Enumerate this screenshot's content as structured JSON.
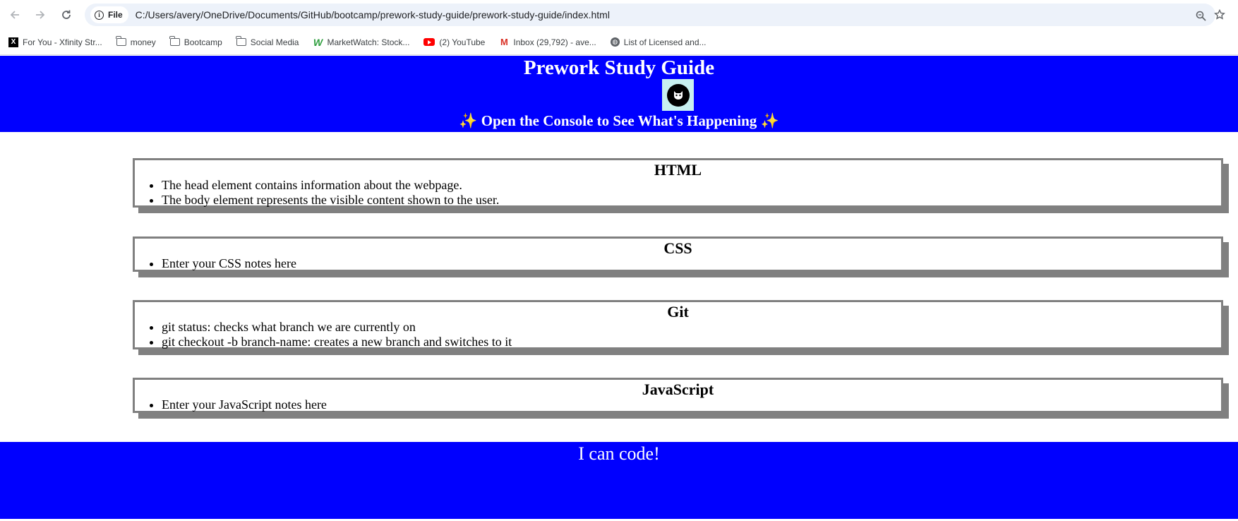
{
  "browser": {
    "site_label": "File",
    "url": "C:/Users/avery/OneDrive/Documents/GitHub/bootcamp/prework-study-guide/prework-study-guide/index.html",
    "icons": [
      "back-icon",
      "forward-icon",
      "reload-icon",
      "info-icon",
      "zoom-icon",
      "star-icon"
    ]
  },
  "bookmarks": [
    {
      "label": "For You - Xfinity Str...",
      "icon": "x-icon"
    },
    {
      "label": "money",
      "icon": "folder-icon"
    },
    {
      "label": "Bootcamp",
      "icon": "folder-icon"
    },
    {
      "label": "Social Media",
      "icon": "folder-icon"
    },
    {
      "label": "MarketWatch: Stock...",
      "icon": "marketwatch-icon"
    },
    {
      "label": "(2) YouTube",
      "icon": "youtube-icon"
    },
    {
      "label": "Inbox (29,792) - ave...",
      "icon": "gmail-icon"
    },
    {
      "label": "List of Licensed and...",
      "icon": "globe-icon"
    }
  ],
  "hero": {
    "title": "Prework Study Guide",
    "subtitle": "Open the Console to See What's Happening",
    "sparkle": "✨",
    "colors": {
      "background": "#0000ff",
      "text": "#ffffff",
      "avatar_bg": "#c8f0f0"
    }
  },
  "sections": [
    {
      "title": "HTML",
      "items": [
        "The head element contains information about the webpage.",
        "The body element represents the visible content shown to the user."
      ]
    },
    {
      "title": "CSS",
      "items": [
        "Enter your CSS notes here"
      ]
    },
    {
      "title": "Git",
      "items": [
        "git status: checks what branch we are currently on",
        "git checkout -b branch-name: creates a new branch and switches to it"
      ]
    },
    {
      "title": "JavaScript",
      "items": [
        "Enter your JavaScript notes here"
      ]
    }
  ],
  "footer": {
    "text": "I can code!"
  }
}
